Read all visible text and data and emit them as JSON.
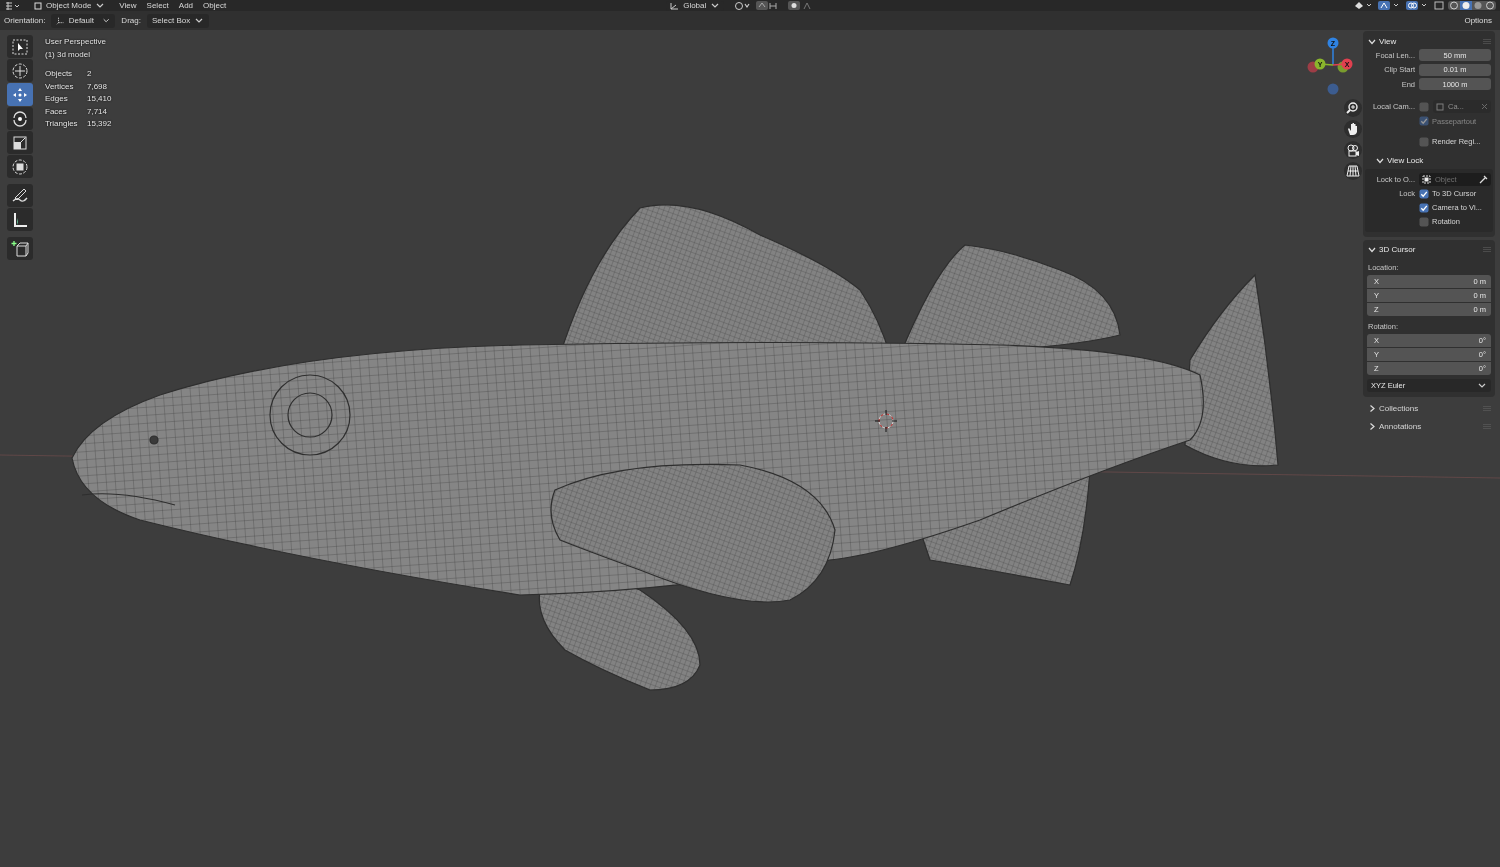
{
  "header": {
    "mode": "Object Mode",
    "menus": [
      "View",
      "Select",
      "Add",
      "Object"
    ],
    "orientation_dropdown": "Global"
  },
  "toolbar": {
    "orientation_label": "Orientation:",
    "orientation_value": "Default",
    "drag_label": "Drag:",
    "drag_value": "Select Box",
    "options": "Options"
  },
  "tools": [
    {
      "kind": "select",
      "selected": false
    },
    {
      "kind": "cursor",
      "selected": false
    },
    {
      "kind": "move",
      "selected": true
    },
    {
      "kind": "rotate",
      "selected": false
    },
    {
      "kind": "scale",
      "selected": false
    },
    {
      "kind": "transform",
      "selected": false
    },
    {
      "kind": "annotate",
      "selected": false
    },
    {
      "kind": "measure",
      "selected": false
    },
    {
      "kind": "add-cube",
      "selected": false
    }
  ],
  "viewport_info": {
    "title": "User Perspective",
    "subtitle": "(1) 3d model",
    "stats": [
      {
        "label": "Objects",
        "value": "2"
      },
      {
        "label": "Vertices",
        "value": "7,698"
      },
      {
        "label": "Edges",
        "value": "15,410"
      },
      {
        "label": "Faces",
        "value": "7,714"
      },
      {
        "label": "Triangles",
        "value": "15,392"
      }
    ]
  },
  "gizmo": {
    "axes": [
      "Z",
      "Y",
      "X"
    ]
  },
  "sidebar": {
    "view": {
      "title": "View",
      "expanded": true,
      "fields": [
        {
          "label": "Focal Len...",
          "value": "50 mm"
        },
        {
          "label": "Clip Start",
          "value": "0.01 m"
        },
        {
          "label": "End",
          "value": "1000 m"
        }
      ],
      "local_camera": {
        "label": "Local Cam...",
        "checked": false,
        "value": "Ca..."
      },
      "passepartout": {
        "label": "Passepartout",
        "checked": true,
        "disabled": true
      },
      "render_region": {
        "label": "Render Regi...",
        "checked": false
      }
    },
    "view_lock": {
      "title": "View Lock",
      "expanded": true,
      "lock_to_label": "Lock to O...",
      "lock_to_placeholder": "Object",
      "lock_label": "Lock",
      "checks": [
        {
          "label": "To 3D Cursor",
          "checked": true
        },
        {
          "label": "Camera to Vi...",
          "checked": true
        },
        {
          "label": "Rotation",
          "checked": false
        }
      ]
    },
    "cursor": {
      "title": "3D Cursor",
      "expanded": true,
      "location_label": "Location:",
      "location": [
        {
          "axis": "X",
          "value": "0 m"
        },
        {
          "axis": "Y",
          "value": "0 m"
        },
        {
          "axis": "Z",
          "value": "0 m"
        }
      ],
      "rotation_label": "Rotation:",
      "rotation": [
        {
          "axis": "X",
          "value": "0°"
        },
        {
          "axis": "Y",
          "value": "0°"
        },
        {
          "axis": "Z",
          "value": "0°"
        }
      ],
      "rotation_mode": "XYZ Euler"
    },
    "collapsed": [
      {
        "title": "Collections",
        "expanded": false
      },
      {
        "title": "Annotations",
        "expanded": false
      }
    ]
  }
}
